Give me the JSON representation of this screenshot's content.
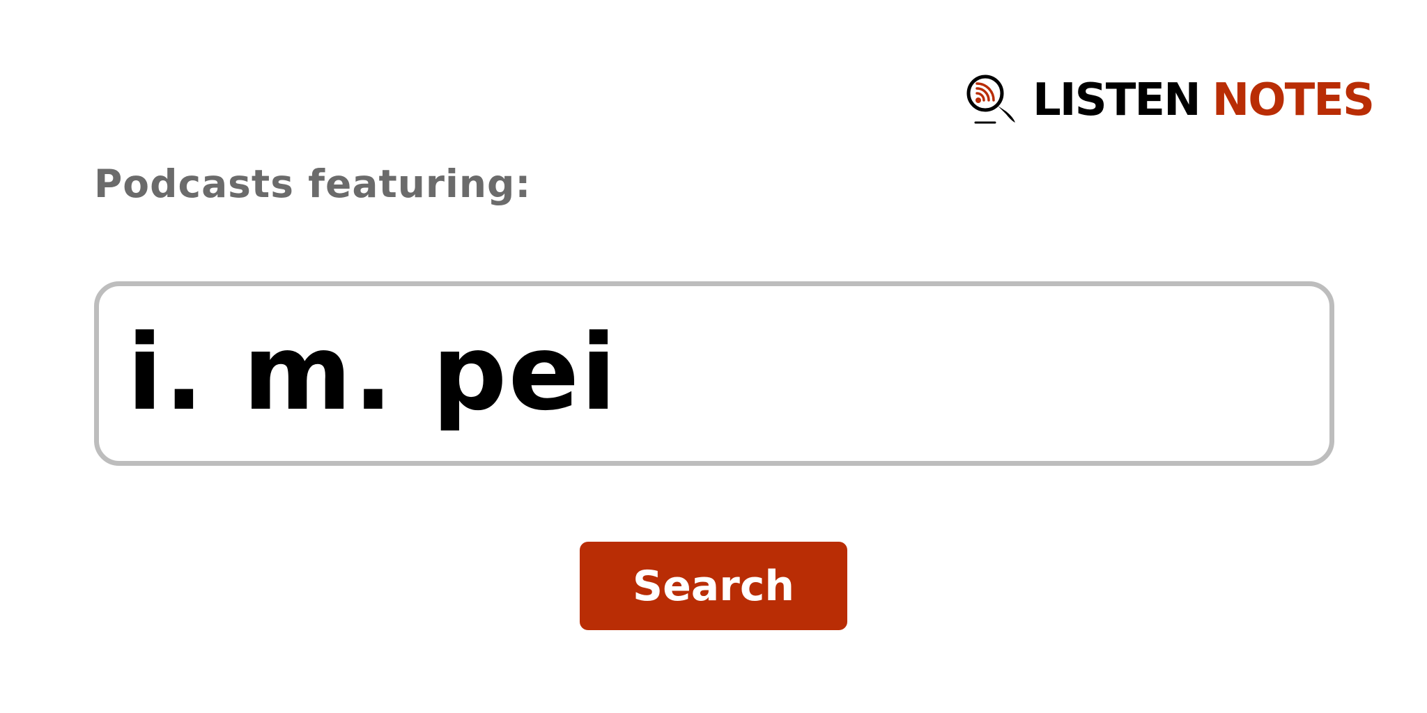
{
  "brand": {
    "name_part1": "LISTEN",
    "name_part2": "NOTES",
    "icon": "magnifier-podcast-icon",
    "colors": {
      "dark": "#000000",
      "accent": "#b92d05"
    }
  },
  "form": {
    "label": "Podcasts featuring:",
    "search_value": "i. m. pei",
    "button_label": "Search"
  },
  "colors": {
    "label_text": "#6b6b6b",
    "input_border": "#bdbdbd",
    "button_bg": "#b92d05",
    "button_text": "#ffffff"
  }
}
